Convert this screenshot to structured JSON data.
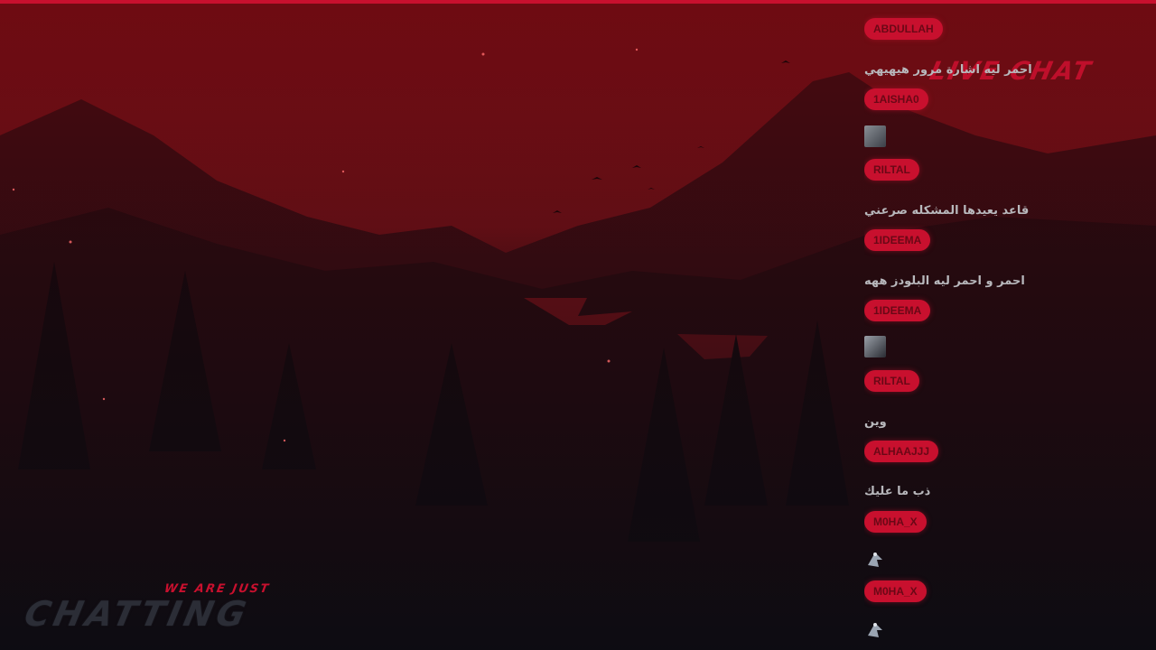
{
  "stream": {
    "logo_text": "LIVE CHAT",
    "tagline_small": "WE ARE JUST",
    "tagline_big": "CHATTING"
  },
  "colors": {
    "accent": "#c8102e",
    "sky_top": "#6e0b12",
    "panel_dark": "#0b0c12",
    "message_text": "#b8b8bc"
  },
  "chat": {
    "messages": [
      {
        "user": "ABDULLAH",
        "text": "احمر ليه اشارة مرور هيهيهي"
      },
      {
        "user": "1AISHA0",
        "emote": "avatar-emote"
      },
      {
        "user": "RILTAL",
        "text": "قاعد يعيدها المشكله صرعني"
      },
      {
        "user": "1IDEEMA",
        "text": "احمر و احمر ليه البلودز ههه"
      },
      {
        "user": "1IDEEMA",
        "emote": "avatar-emote"
      },
      {
        "user": "RILTAL",
        "text": "وين"
      },
      {
        "user": "ALHAAJJJ",
        "text": "ذب ما عليك"
      },
      {
        "user": "M0HA_X",
        "emote": "bird-emote"
      },
      {
        "user": "M0HA_X",
        "emote": "bird-emote"
      }
    ]
  }
}
